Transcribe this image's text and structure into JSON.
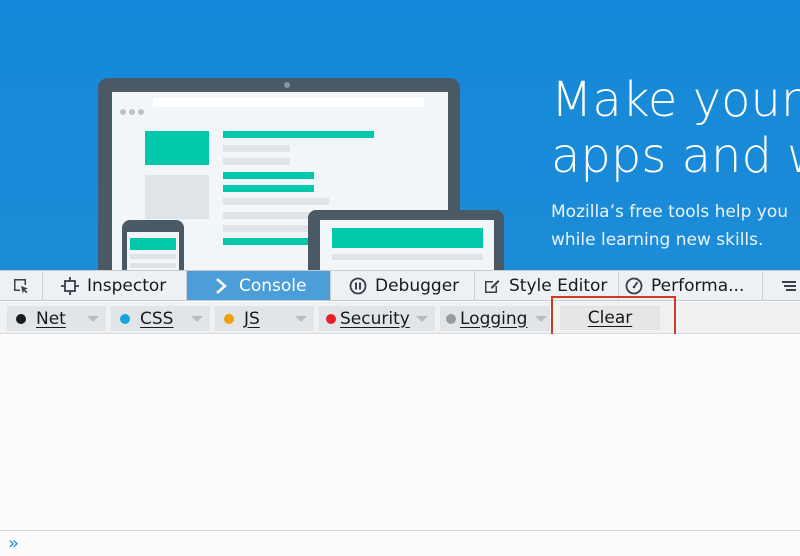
{
  "hero": {
    "title_line1": "Make your",
    "title_line2": "apps and w",
    "subtitle_line1": "Mozilla’s free tools help you",
    "subtitle_line2": "while learning new skills."
  },
  "devtools": {
    "tabs": [
      {
        "label": "",
        "icon": "pick-element-icon",
        "selected": false
      },
      {
        "label": "Inspector",
        "icon": "inspector-icon",
        "selected": false
      },
      {
        "label": "Console",
        "icon": "console-chevron-icon",
        "selected": true
      },
      {
        "label": "Debugger",
        "icon": "pause-icon",
        "selected": false
      },
      {
        "label": "Style Editor",
        "icon": "style-editor-icon",
        "selected": false
      },
      {
        "label": "Performa...",
        "icon": "gauge-icon",
        "selected": false
      },
      {
        "label": "",
        "icon": "more-tools-icon",
        "selected": false
      }
    ],
    "filters": [
      {
        "label": "Net",
        "color": "#1b1b1b"
      },
      {
        "label": "CSS",
        "color": "#1aa2e0"
      },
      {
        "label": "JS",
        "color": "#f0a000"
      },
      {
        "label": "Security",
        "color": "#e8202a"
      },
      {
        "label": "Logging",
        "color": "#9b9b9b"
      }
    ],
    "clear_label": "Clear",
    "input_value": ""
  },
  "colors": {
    "hero_bg": "#1d8cd8",
    "selected_tab": "#4c9ed9",
    "highlight": "#cc3d1f",
    "teal": "#00c8aa"
  }
}
